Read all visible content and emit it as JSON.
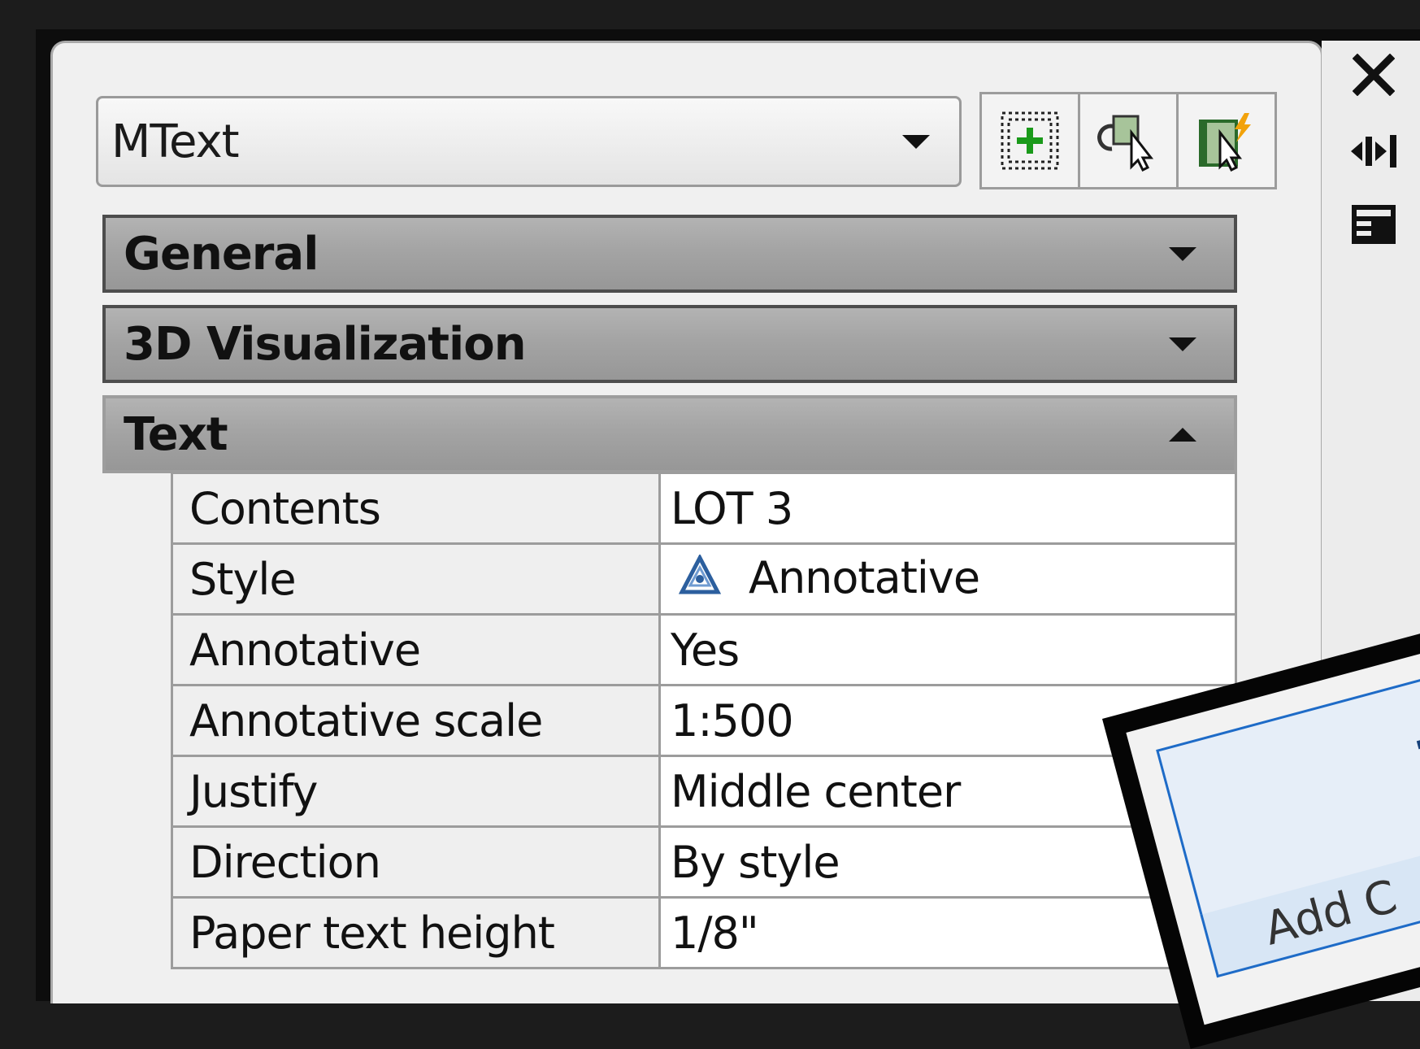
{
  "object_selector": {
    "value": "MText"
  },
  "toolbar": {
    "buttons": [
      {
        "icon": "toggle-pickadd-icon"
      },
      {
        "icon": "select-objects-icon"
      },
      {
        "icon": "quick-select-icon"
      }
    ]
  },
  "side_strip": {
    "icons": [
      "close-icon",
      "auto-hide-icon",
      "properties-settings-icon"
    ]
  },
  "sections": {
    "general": {
      "title": "General",
      "state": "collapsed"
    },
    "visualization_3d": {
      "title": "3D Visualization",
      "state": "collapsed"
    },
    "text": {
      "title": "Text",
      "state": "expanded"
    }
  },
  "text_properties": [
    {
      "name": "Contents",
      "value": "LOT 3"
    },
    {
      "name": "Style",
      "value": "Annotative",
      "icon": "annotative-icon"
    },
    {
      "name": "Annotative",
      "value": "Yes"
    },
    {
      "name": "Annotative scale",
      "value": "1:500"
    },
    {
      "name": "Justify",
      "value": "Middle center"
    },
    {
      "name": "Direction",
      "value": "By style"
    },
    {
      "name": "Paper text height",
      "value": "1/8\""
    }
  ],
  "overlay": {
    "label": "Add C"
  },
  "colors": {
    "section_header": "#a4a4a4",
    "panel_bg": "#f0f0f0",
    "overlay_border": "#1e6bc7"
  }
}
